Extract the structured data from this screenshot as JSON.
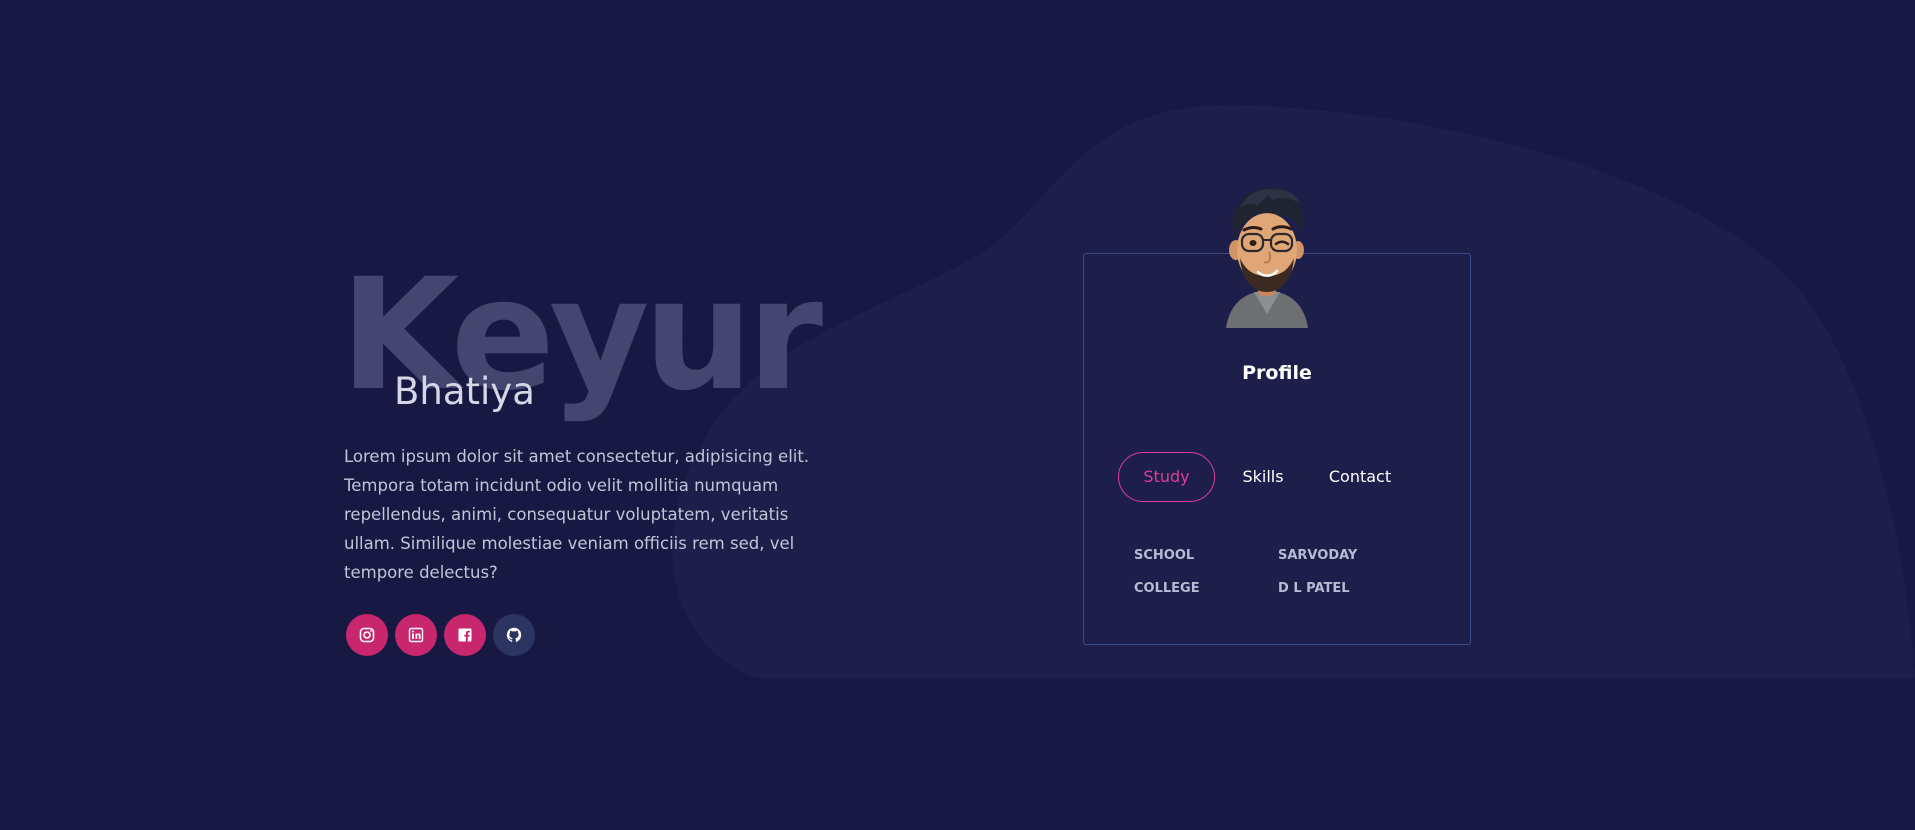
{
  "hero": {
    "first_name": "Keyur",
    "last_name": "Bhatiya",
    "intro": "Lorem ipsum dolor sit amet consectetur, adipisicing elit. Tempora totam incidunt odio velit mollitia numquam repellendus, animi, consequatur voluptatem, veritatis ullam. Similique molestiae veniam officiis rem sed, vel tempore delectus?"
  },
  "socials": [
    {
      "icon": "instagram-icon",
      "color": "#c8266d"
    },
    {
      "icon": "linkedin-icon",
      "color": "#c8266d"
    },
    {
      "icon": "facebook-icon",
      "color": "#c8266d"
    },
    {
      "icon": "github-icon",
      "color": "#2c3561"
    }
  ],
  "profile": {
    "title": "Profile",
    "avatar": "memoji-avatar",
    "tabs": [
      "Study",
      "Skills",
      "Contact"
    ],
    "active_tab": "Study",
    "study": [
      {
        "label": "SCHOOL",
        "value": "SARVODAY"
      },
      {
        "label": "COLLEGE",
        "value": "D L PATEL"
      }
    ]
  },
  "colors": {
    "background": "#171943",
    "accent": "#e13c96",
    "social": "#c8266d",
    "card_border": "#3b4c85"
  }
}
